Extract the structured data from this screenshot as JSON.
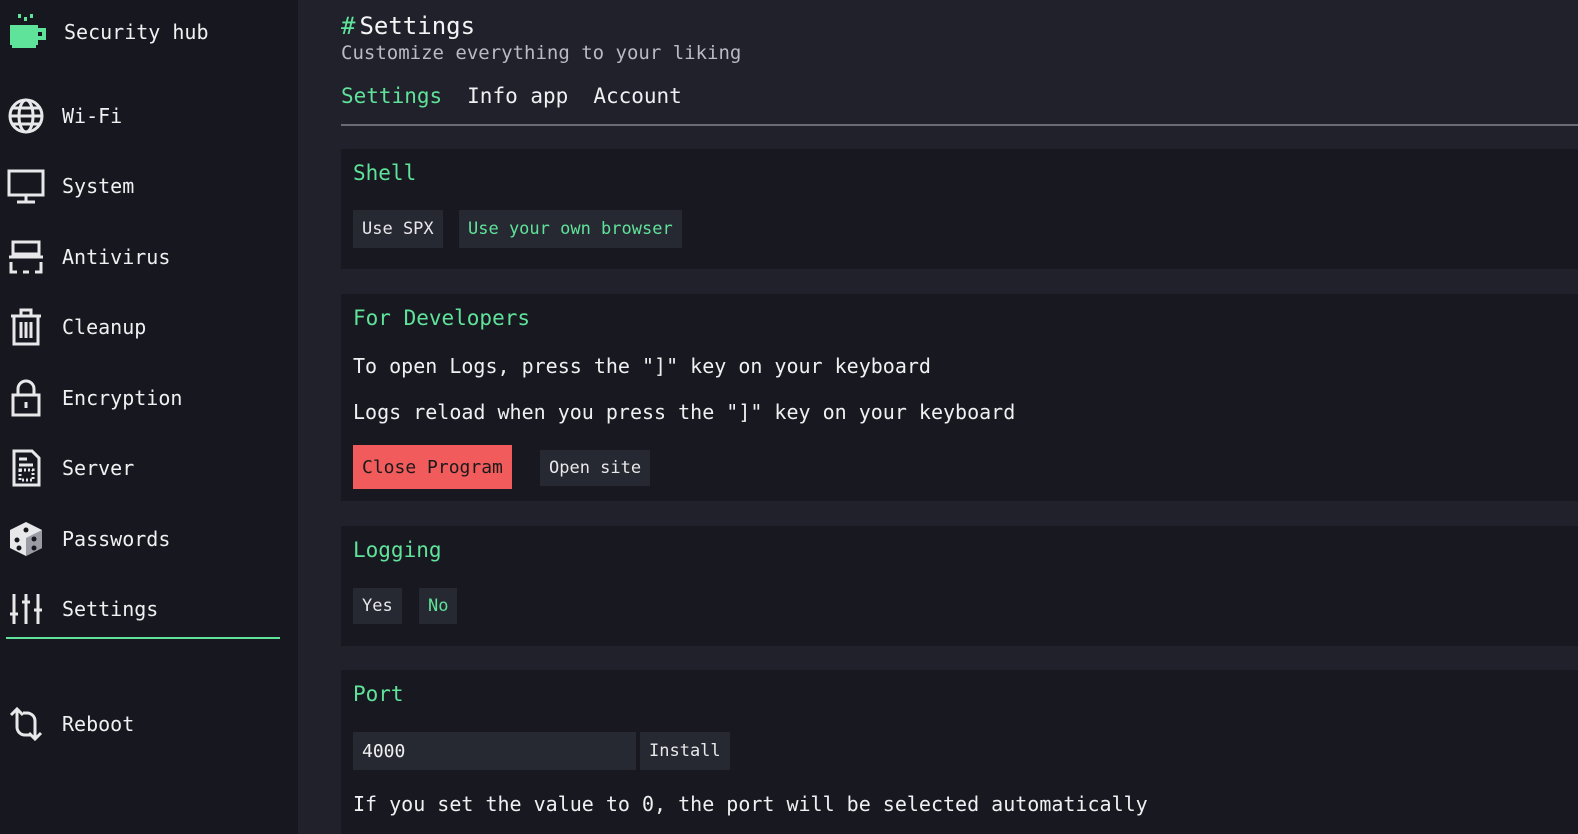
{
  "app": {
    "title": "Security hub"
  },
  "colors": {
    "accent": "#5fe39a",
    "danger": "#f25b5b",
    "background": "#20212b",
    "sidebar": "#17181f",
    "card": "#181920"
  },
  "sidebar": {
    "items": [
      {
        "label": "Wi-Fi",
        "icon": "globe-icon"
      },
      {
        "label": "System",
        "icon": "monitor-icon"
      },
      {
        "label": "Antivirus",
        "icon": "scanner-icon"
      },
      {
        "label": "Cleanup",
        "icon": "trash-icon"
      },
      {
        "label": "Encryption",
        "icon": "lock-icon"
      },
      {
        "label": "Server",
        "icon": "document-icon"
      },
      {
        "label": "Passwords",
        "icon": "dice-icon"
      },
      {
        "label": "Settings",
        "icon": "sliders-icon",
        "active": true
      }
    ],
    "reboot": {
      "label": "Reboot",
      "icon": "reboot-icon"
    }
  },
  "header": {
    "hash": "#",
    "title": "Settings",
    "subtitle": "Customize everything to your liking"
  },
  "tabs": [
    {
      "label": "Settings",
      "active": true
    },
    {
      "label": "Info app"
    },
    {
      "label": "Account"
    }
  ],
  "sections": {
    "shell": {
      "title": "Shell",
      "buttons": [
        "Use SPX",
        "Use your own browser"
      ],
      "selected": "Use your own browser"
    },
    "developers": {
      "title": "For Developers",
      "line1": "To open Logs, press the \"]\" key on your keyboard",
      "line2": "Logs reload when you press the \"]\" key on your keyboard",
      "close_label": "Close Program",
      "open_site_label": "Open site"
    },
    "logging": {
      "title": "Logging",
      "yes_label": "Yes",
      "no_label": "No",
      "selected": "No"
    },
    "port": {
      "title": "Port",
      "value": "4000",
      "install_label": "Install",
      "hint": "If you set the value to 0, the port will be selected automatically"
    }
  }
}
